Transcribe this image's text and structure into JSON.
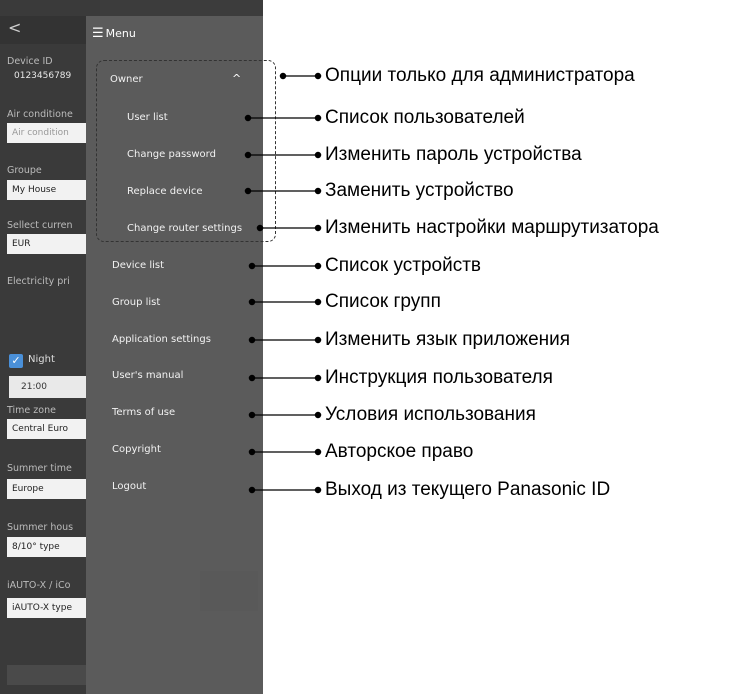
{
  "background": {
    "back": "<",
    "fields": [
      {
        "label": "Device ID",
        "value": "0123456789"
      },
      {
        "label": "Air conditione",
        "value": "Air condition"
      },
      {
        "label": "Groupe",
        "value": "My House"
      },
      {
        "label": "Sellect curren",
        "value": "EUR"
      },
      {
        "label": "Electricity pri",
        "value": ""
      },
      {
        "label": "Time zone",
        "value": "Central Euro"
      },
      {
        "label": "Summer time",
        "value": "Europe"
      },
      {
        "label": "Summer hous",
        "value": "8/10° type"
      },
      {
        "label": "iAUTO-X / iCo",
        "value": "iAUTO-X type"
      }
    ],
    "night_label": "Night",
    "night_time": "21:00"
  },
  "menu": {
    "title": "Menu",
    "items": [
      {
        "label": "Owner"
      },
      {
        "label": "User list"
      },
      {
        "label": "Change password"
      },
      {
        "label": "Replace device"
      },
      {
        "label": "Change router settings"
      },
      {
        "label": "Device list"
      },
      {
        "label": "Group list"
      },
      {
        "label": "Application settings"
      },
      {
        "label": "User's manual"
      },
      {
        "label": "Terms of use"
      },
      {
        "label": "Copyright"
      },
      {
        "label": "Logout"
      }
    ]
  },
  "annotations": [
    "Опции только для администратора",
    "Список пользователей",
    "Изменить пароль устройства",
    "Заменить устройство",
    "Изменить настройки маршрутизатора",
    "Список устройств",
    "Список групп",
    "Изменить язык приложения",
    "Инструкция пользователя",
    "Условия использования",
    "Авторское право",
    "Выход из текущего Panasonic ID"
  ]
}
